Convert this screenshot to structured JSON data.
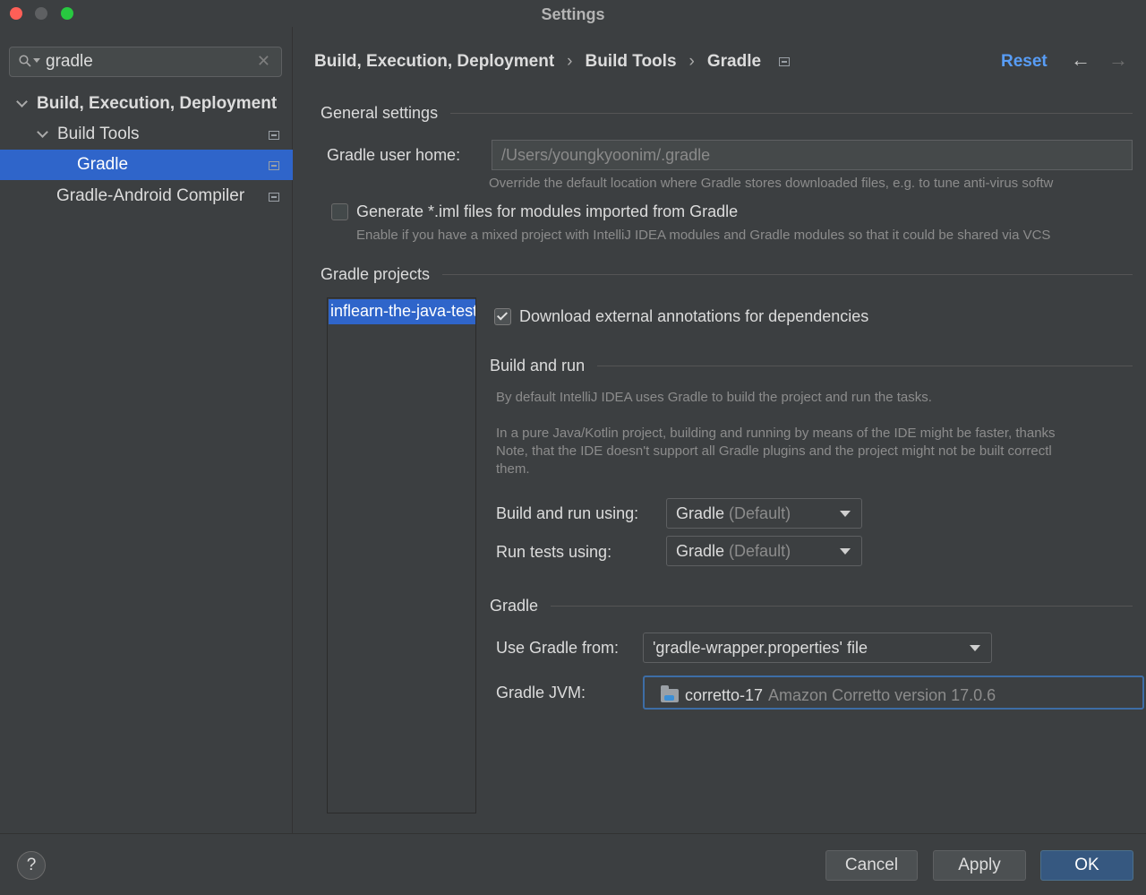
{
  "window": {
    "title": "Settings"
  },
  "search": {
    "value": "gradle"
  },
  "tree": [
    {
      "label": "Build, Execution, Deployment"
    },
    {
      "label": "Build Tools"
    },
    {
      "label": "Gradle"
    },
    {
      "label": "Gradle-Android Compiler"
    }
  ],
  "breadcrumb": [
    "Build, Execution, Deployment",
    "Build Tools",
    "Gradle"
  ],
  "header": {
    "reset_label": "Reset",
    "back_icon": "←",
    "forward_icon": "→"
  },
  "general": {
    "title": "General settings",
    "user_home_label": "Gradle user home:",
    "user_home_value": "/Users/youngkyoonim/.gradle",
    "user_home_hint": "Override the default location where Gradle stores downloaded files, e.g. to tune anti-virus softw",
    "iml_label": "Generate *.iml files for modules imported from Gradle",
    "iml_hint": "Enable if you have a mixed project with IntelliJ IDEA modules and Gradle modules so that it could be shared via VCS",
    "iml_checked": false
  },
  "projects": {
    "title": "Gradle projects",
    "items": [
      "inflearn-the-java-test"
    ],
    "download_label": "Download external annotations for dependencies",
    "download_checked": true
  },
  "build_run": {
    "title": "Build and run",
    "desc1": "By default IntelliJ IDEA uses Gradle to build the project and run the tasks.",
    "desc2": "In a pure Java/Kotlin project, building and running by means of the IDE might be faster, thanks",
    "desc3": "Note, that the IDE doesn't support all Gradle plugins and the project might not be built correctl",
    "desc4": "them.",
    "build_using_label": "Build and run using:",
    "build_using_value": "Gradle",
    "build_using_suffix": "(Default)",
    "tests_using_label": "Run tests using:",
    "tests_using_value": "Gradle",
    "tests_using_suffix": "(Default)"
  },
  "gradle": {
    "title": "Gradle",
    "use_from_label": "Use Gradle from:",
    "use_from_value": "'gradle-wrapper.properties' file",
    "jvm_label": "Gradle JVM:",
    "jvm_name": "corretto-17",
    "jvm_desc": "Amazon Corretto version 17.0.6"
  },
  "footer": {
    "help_label": "?",
    "cancel_label": "Cancel",
    "apply_label": "Apply",
    "ok_label": "OK"
  }
}
